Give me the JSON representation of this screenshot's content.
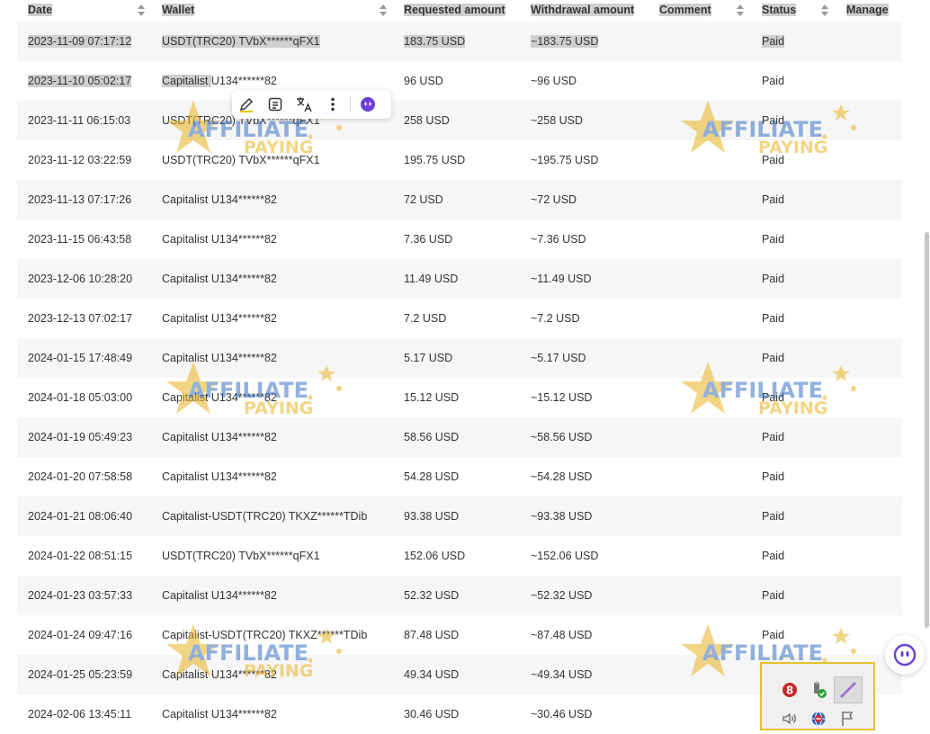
{
  "table": {
    "headers": [
      "Date",
      "Wallet",
      "Requested amount",
      "Withdrawal amount",
      "Comment",
      "Status",
      "Manage"
    ],
    "rows": [
      {
        "date": "2023-11-09 07:17:12",
        "wallet": "USDT(TRC20) TVbX******qFX1",
        "requested": "183.75 USD",
        "withdrawal": "~183.75 USD",
        "comment": "",
        "status": "Paid"
      },
      {
        "date": "2023-11-10 05:02:17",
        "wallet": "Capitalist U134******82",
        "requested": "96 USD",
        "withdrawal": "~96 USD",
        "comment": "",
        "status": "Paid"
      },
      {
        "date": "2023-11-11 06:15:03",
        "wallet": "USDT(TRC20) TVbX******qFX1",
        "requested": "258 USD",
        "withdrawal": "~258 USD",
        "comment": "",
        "status": "Paid"
      },
      {
        "date": "2023-11-12 03:22:59",
        "wallet": "USDT(TRC20) TVbX******qFX1",
        "requested": "195.75 USD",
        "withdrawal": "~195.75 USD",
        "comment": "",
        "status": "Paid"
      },
      {
        "date": "2023-11-13 07:17:26",
        "wallet": "Capitalist U134******82",
        "requested": "72 USD",
        "withdrawal": "~72 USD",
        "comment": "",
        "status": "Paid"
      },
      {
        "date": "2023-11-15 06:43:58",
        "wallet": "Capitalist U134******82",
        "requested": "7.36 USD",
        "withdrawal": "~7.36 USD",
        "comment": "",
        "status": "Paid"
      },
      {
        "date": "2023-12-06 10:28:20",
        "wallet": "Capitalist U134******82",
        "requested": "11.49 USD",
        "withdrawal": "~11.49 USD",
        "comment": "",
        "status": "Paid"
      },
      {
        "date": "2023-12-13 07:02:17",
        "wallet": "Capitalist U134******82",
        "requested": "7.2 USD",
        "withdrawal": "~7.2 USD",
        "comment": "",
        "status": "Paid"
      },
      {
        "date": "2024-01-15 17:48:49",
        "wallet": "Capitalist U134******82",
        "requested": "5.17 USD",
        "withdrawal": "~5.17 USD",
        "comment": "",
        "status": "Paid"
      },
      {
        "date": "2024-01-18 05:03:00",
        "wallet": "Capitalist U134******82",
        "requested": "15.12 USD",
        "withdrawal": "~15.12 USD",
        "comment": "",
        "status": "Paid"
      },
      {
        "date": "2024-01-19 05:49:23",
        "wallet": "Capitalist U134******82",
        "requested": "58.56 USD",
        "withdrawal": "~58.56 USD",
        "comment": "",
        "status": "Paid"
      },
      {
        "date": "2024-01-20 07:58:58",
        "wallet": "Capitalist U134******82",
        "requested": "54.28 USD",
        "withdrawal": "~54.28 USD",
        "comment": "",
        "status": "Paid"
      },
      {
        "date": "2024-01-21 08:06:40",
        "wallet": "Capitalist-USDT(TRC20) TKXZ******TDib",
        "requested": "93.38 USD",
        "withdrawal": "~93.38 USD",
        "comment": "",
        "status": "Paid"
      },
      {
        "date": "2024-01-22 08:51:15",
        "wallet": "USDT(TRC20) TVbX******qFX1",
        "requested": "152.06 USD",
        "withdrawal": "~152.06 USD",
        "comment": "",
        "status": "Paid"
      },
      {
        "date": "2024-01-23 03:57:33",
        "wallet": "Capitalist U134******82",
        "requested": "52.32 USD",
        "withdrawal": "~52.32 USD",
        "comment": "",
        "status": "Paid"
      },
      {
        "date": "2024-01-24 09:47:16",
        "wallet": "Capitalist-USDT(TRC20) TKXZ******TDib",
        "requested": "87.48 USD",
        "withdrawal": "~87.48 USD",
        "comment": "",
        "status": "Paid"
      },
      {
        "date": "2024-01-25 05:23:59",
        "wallet": "Capitalist U134******82",
        "requested": "49.34 USD",
        "withdrawal": "~49.34 USD",
        "comment": "",
        "status": "Paid"
      },
      {
        "date": "2024-02-06 13:45:11",
        "wallet": "Capitalist U134******82",
        "requested": "30.46 USD",
        "withdrawal": "~30.46 USD",
        "comment": "",
        "status": "Paid"
      }
    ]
  },
  "watermark": {
    "line1": "AFFILIATE",
    "line2": "PAYING"
  },
  "colors": {
    "accent_purple": "#6b3fd4",
    "watermark_blue": "#3a73c4",
    "watermark_gold": "#e8b321",
    "selection_grey": "#cfcfcf",
    "row_alt": "#f6f6f6"
  },
  "toolbar_icons": [
    "pen-icon",
    "summary-icon",
    "translate-icon",
    "more-icon",
    "assistant-icon"
  ],
  "tray_icons": [
    "antivirus-icon",
    "usb-safe-remove-icon",
    "pen-tablet-icon",
    "volume-icon",
    "network-icon",
    "flag-icon"
  ]
}
